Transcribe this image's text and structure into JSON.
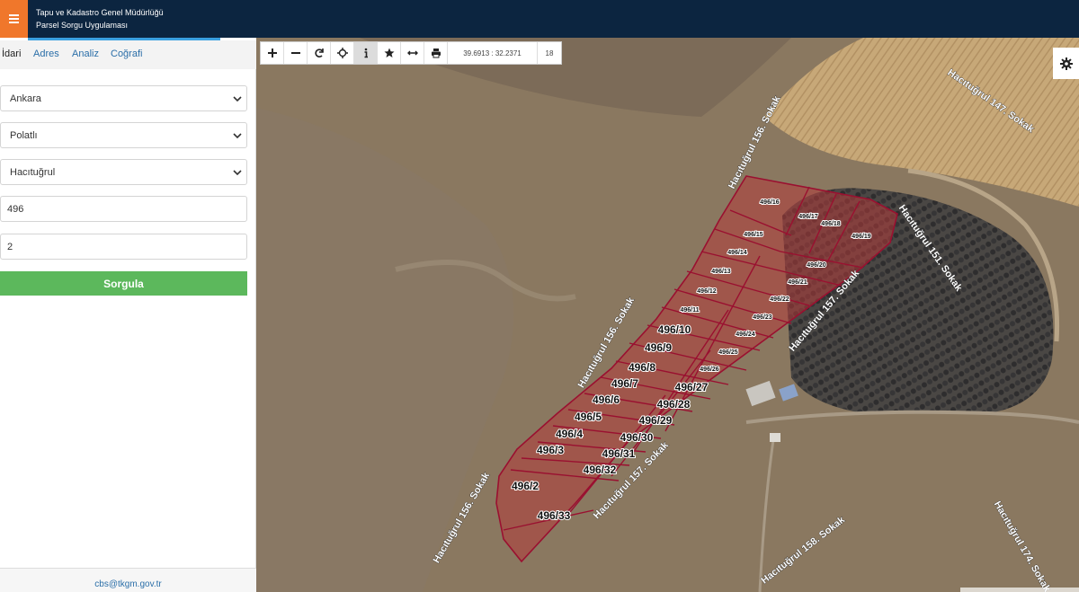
{
  "header": {
    "title_line1": "Tapu ve Kadastro Genel Müdürlüğü",
    "title_line2": "Parsel Sorgu Uygulaması"
  },
  "sidebar": {
    "tabs": [
      {
        "label": "İdari",
        "active": true
      },
      {
        "label": "Adres",
        "active": false
      },
      {
        "label": "Analiz",
        "active": false
      },
      {
        "label": "Coğrafi",
        "active": false
      }
    ],
    "il": "Ankara",
    "ilce": "Polatlı",
    "mahalle": "Hacıtuğrul",
    "ada": "496",
    "parsel": "2",
    "submit_label": "Sorgula",
    "footer_email": "cbs@tkgm.gov.tr"
  },
  "toolbar": {
    "buttons": [
      "zoom-in-icon",
      "zoom-out-icon",
      "refresh-icon",
      "locate-icon",
      "info-icon",
      "star-icon",
      "measure-icon",
      "print-icon"
    ],
    "coordinates": "39.6913 : 32.2371",
    "zoom_level": "18"
  },
  "map": {
    "parcel_fill": "#b23a3a",
    "parcel_stroke": "#9a1030",
    "street_labels": [
      "Hacıtuğrul 156. Sokak",
      "Hacıtuğrul 147. Sokak",
      "Hacıtuğrul 151. Sokak",
      "Hacıtuğrul 157. Sokak",
      "Hacıtuğrul 156. Sokak",
      "Hacıtuğrul 157. Sokak",
      "Hacıtuğrul 156. Sokak",
      "Hacıtuğrul 158. Sokak",
      "Hacıtuğrul 174. Sokak"
    ],
    "parcel_labels": [
      "496/16",
      "496/17",
      "496/18",
      "496/19",
      "496/15",
      "496/14",
      "496/20",
      "496/13",
      "496/21",
      "496/12",
      "496/22",
      "496/11",
      "496/23",
      "496/10",
      "496/24",
      "496/9",
      "496/25",
      "496/8",
      "496/26",
      "496/7",
      "496/27",
      "496/6",
      "496/28",
      "496/5",
      "496/29",
      "496/4",
      "496/30",
      "496/3",
      "496/31",
      "496/32",
      "496/2",
      "496/33"
    ]
  }
}
